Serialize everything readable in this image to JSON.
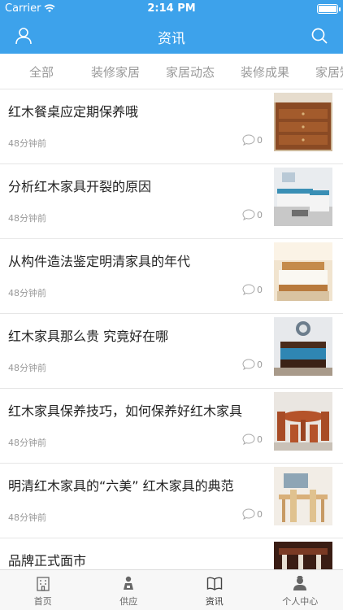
{
  "status": {
    "carrier": "Carrier",
    "time": "2:14 PM"
  },
  "navbar": {
    "title": "资讯",
    "left_icon": "user-icon",
    "right_icon": "search-icon"
  },
  "tabs": [
    {
      "label": "全部"
    },
    {
      "label": "装修家居"
    },
    {
      "label": "家居动态"
    },
    {
      "label": "装修成果"
    },
    {
      "label": "家居知"
    }
  ],
  "articles": [
    {
      "title": "红木餐桌应定期保养哦",
      "time": "48分钟前",
      "comments": "0"
    },
    {
      "title": "分析红木家具开裂的原因",
      "time": "48分钟前",
      "comments": "0"
    },
    {
      "title": "从构件造法鉴定明清家具的年代",
      "time": "48分钟前",
      "comments": "0"
    },
    {
      "title": "红木家具那么贵 究竟好在哪",
      "time": "48分钟前",
      "comments": "0"
    },
    {
      "title": "红木家具保养技巧，如何保养好红木家具",
      "time": "48分钟前",
      "comments": "0"
    },
    {
      "title": "明清红木家具的“六美” 红木家具的典范",
      "time": "48分钟前",
      "comments": "0"
    },
    {
      "title": "品牌正式面市",
      "time": "",
      "comments": ""
    }
  ],
  "tabbar": [
    {
      "label": "首页",
      "icon": "building-icon"
    },
    {
      "label": "供应",
      "icon": "supply-icon"
    },
    {
      "label": "资讯",
      "icon": "book-icon"
    },
    {
      "label": "个人中心",
      "icon": "profile-icon"
    }
  ]
}
